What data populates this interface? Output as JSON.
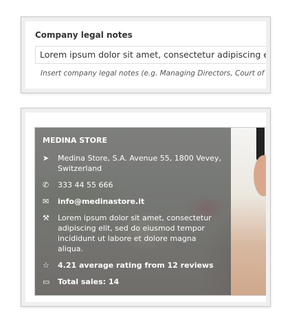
{
  "legal_notes": {
    "label": "Company legal notes",
    "value": "Lorem ipsum dolor sit amet, consectetur adipiscing elit, sed do eiusmod",
    "help": "Insert company legal notes (e.g. Managing Directors, Court of registration)"
  },
  "store": {
    "name": "MEDINA STORE",
    "address_line1": "Medina Store, S.A. Avenue 55, 1800 Vevey,",
    "address_line2": "Switzerland",
    "phone": "333 44 55 666",
    "email": "info@medinastore.it",
    "description": "Lorem ipsum dolor sit amet, consectetur adipiscing elit, sed do eiusmod tempor incididunt ut labore et dolore magna aliqua.",
    "rating": "4.21 average rating from 12 reviews",
    "sales": "Total sales: 14"
  }
}
